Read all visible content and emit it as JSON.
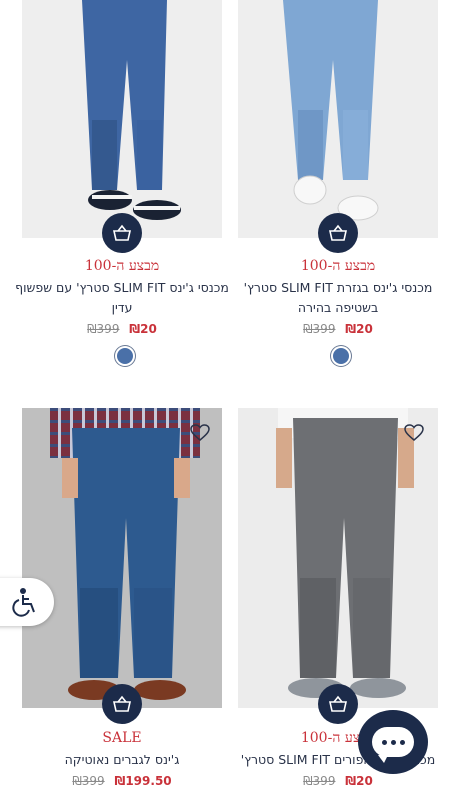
{
  "colors": {
    "accent": "#1c2b4a",
    "promo": "#c9323a",
    "swatch": "#4a70a8"
  },
  "products": [
    {
      "promo": "מבצע ה-100",
      "title": "מכנסי ג'ינס SLIM FIT סטרץ' עם שפשוף עדין",
      "sale_price": "₪20",
      "original_price": "₪399",
      "swatch_color": "#4a70a8",
      "image_desc": "dark-blue-jeans-with-sneakers"
    },
    {
      "promo": "מבצע ה-100",
      "title": "מכנסי ג'ינס בגזרת SLIM FIT סטרץ' בשטיפה בהירה",
      "sale_price": "₪20",
      "original_price": "₪399",
      "swatch_color": "#4a70a8",
      "image_desc": "light-blue-jeans-with-white-shoes"
    },
    {
      "promo": "SALE",
      "title": "ג'ינס לגברים נאוטיקה",
      "sale_price": "₪199.50",
      "original_price": "₪399",
      "image_desc": "dark-wash-jeans-plaid-shirt"
    },
    {
      "promo": "מבצע ה-100",
      "title": "מכנסי ג'ינס אפורים SLIM FIT סטרץ'",
      "sale_price": "₪20",
      "original_price": "₪399",
      "image_desc": "grey-jeans-white-tshirt"
    }
  ],
  "icons": {
    "cart": "shopping-basket-icon",
    "wishlist": "heart-icon",
    "accessibility": "wheelchair-icon",
    "chat": "chat-bubble-icon"
  }
}
